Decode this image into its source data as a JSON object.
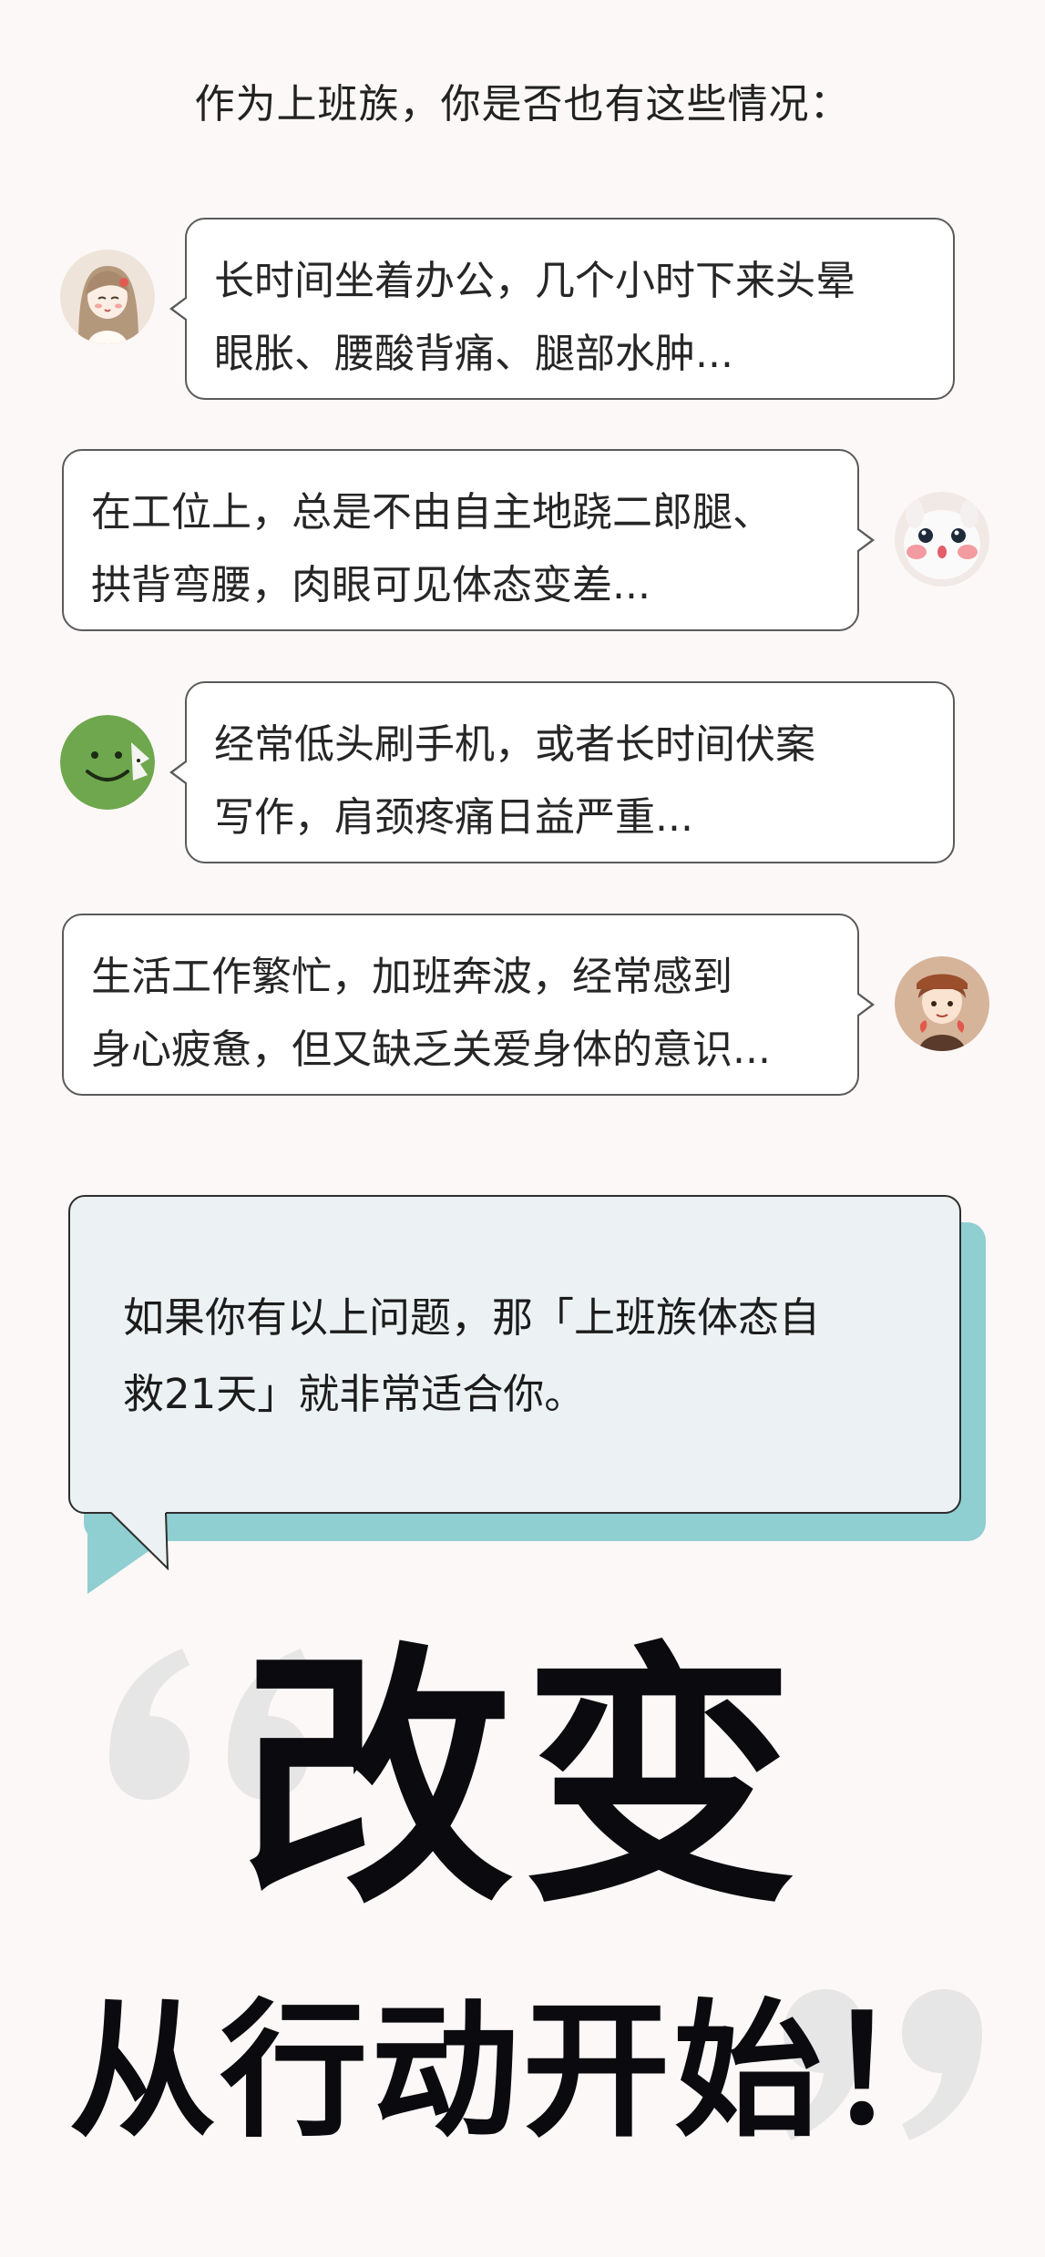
{
  "intro": "作为上班族，你是否也有这些情况：",
  "chats": [
    {
      "lines": [
        "长时间坐着办公，几个小时下来头晕",
        "眼胀、腰酸背痛、腿部水肿..."
      ],
      "avatar": "girl-avatar"
    },
    {
      "lines": [
        "在工位上，总是不由自主地跷二郎腿、",
        "拱背弯腰，肉眼可见体态变差..."
      ],
      "avatar": "plush-bunny-avatar"
    },
    {
      "lines": [
        "经常低头刷手机，或者长时间伏案",
        "写作，肩颈疼痛日益严重..."
      ],
      "avatar": "green-smiley-avatar"
    },
    {
      "lines": [
        "生活工作繁忙，加班奔波，经常感到",
        "身心疲惫，但又缺乏关爱身体的意识..."
      ],
      "avatar": "boy-avatar"
    }
  ],
  "callout": {
    "line1": "如果你有以上问题，那「上班族体态自",
    "line2": "救21天」就非常适合你。"
  },
  "headline": {
    "line1": "改变",
    "line2": "从行动开始！"
  },
  "colors": {
    "background": "#fcf8f7",
    "callout_fill": "#ecf2f4",
    "callout_shadow": "#8fcfd1",
    "headline": "#0b0b0f"
  }
}
